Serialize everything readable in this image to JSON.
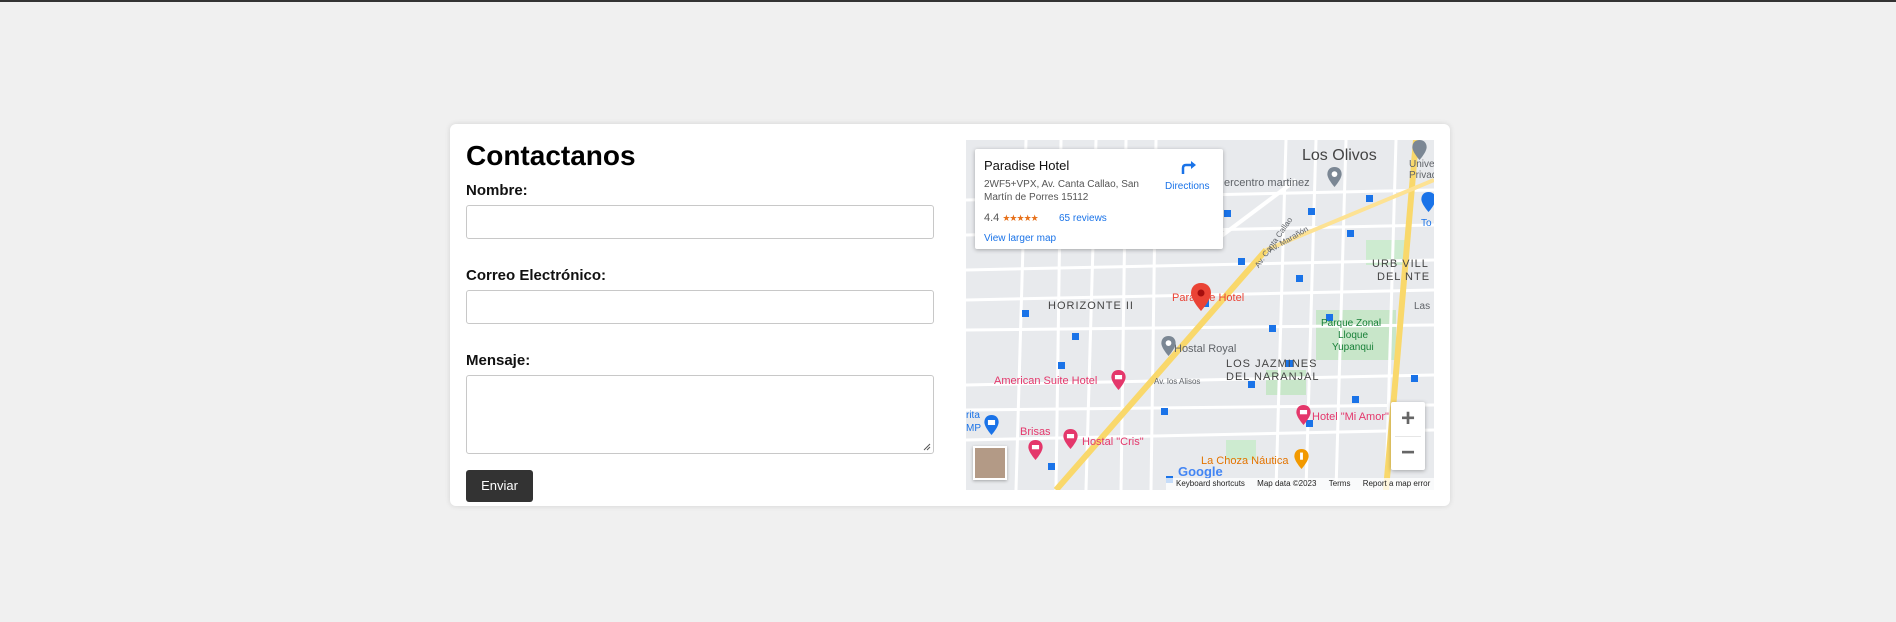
{
  "form": {
    "title": "Contactanos",
    "name_label": "Nombre:",
    "email_label": "Correo Electrónico:",
    "message_label": "Mensaje:",
    "submit_label": "Enviar"
  },
  "map": {
    "place_name": "Paradise Hotel",
    "address": "2WF5+VPX, Av. Canta Callao, San Martín de Porres 15112",
    "rating": "4.4",
    "stars": "★★★★★",
    "reviews": "65 reviews",
    "view_larger": "View larger map",
    "directions": "Directions",
    "google_logo": "Google",
    "footer": {
      "shortcuts": "Keyboard shortcuts",
      "map_data": "Map data ©2023",
      "terms": "Terms",
      "report": "Report a map error"
    },
    "labels": {
      "los_olivos": "Los Olivos",
      "universidad": "Univer",
      "privada": "Privad",
      "supercentro": "ercentro martinez",
      "urb_villa": "URB VILL",
      "del_nte": "DEL NTE",
      "las": "Las",
      "horizonte": "HORIZONTE II",
      "paradise_marker": "Paradise Hotel",
      "parque_zonal": "Parque Zonal",
      "lloque": "Lloque",
      "yupanqui": "Yupanqui",
      "hostal_royal": "Hostal Royal",
      "los_jazmines": "LOS JAZMINES",
      "del_naranjal": "DEL NARANJAL",
      "american_suite": "American Suite Hotel",
      "av_los_alisos": "Av. los Alisos",
      "hotel_mi_amor": "Hotel \"Mi Amor\"",
      "brisas": "Brisas",
      "hostal_cris": "Hostal \"Cris\"",
      "la_choza": "La Choza Náutica",
      "tottus_left": "rita",
      "mp": "MP",
      "av_canta_callao": "Av. Canta Callao",
      "av_marañon": "Av. Marañón",
      "to": "To"
    }
  },
  "colors": {
    "button_bg": "#333333",
    "link_blue": "#1a73e8",
    "star_orange": "#e7711b",
    "hotel_pink": "#e4376b",
    "park_green": "#188038",
    "marker_red": "#ea4335"
  }
}
